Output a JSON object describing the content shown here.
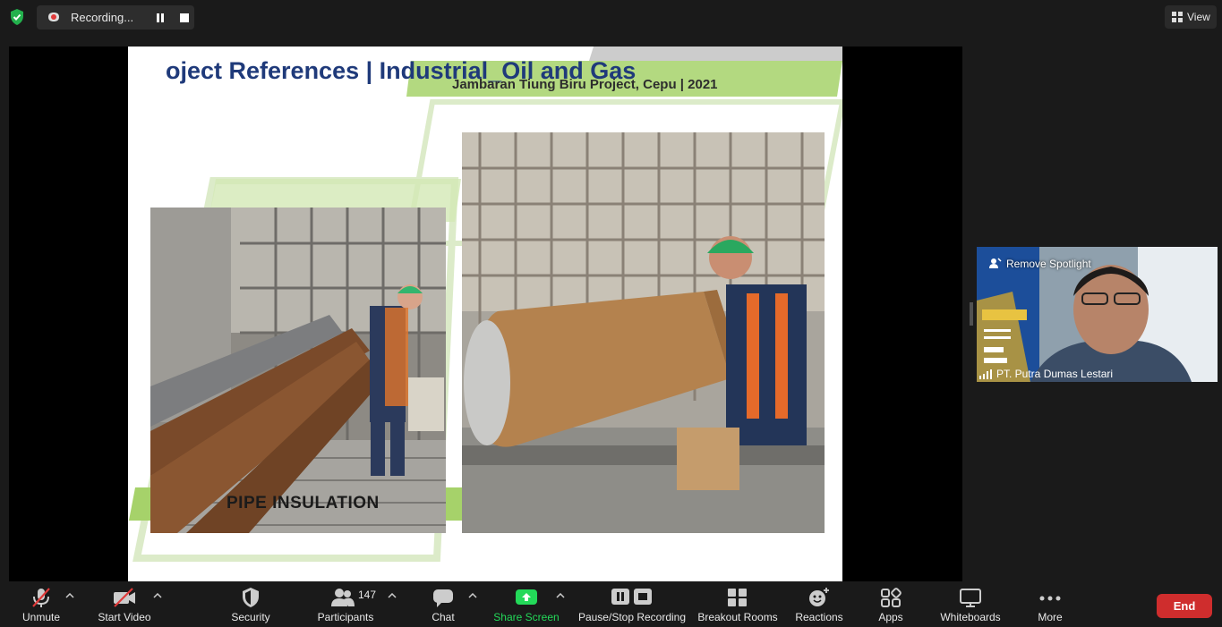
{
  "topbar": {
    "recording_label": "Recording...",
    "view_label": "View"
  },
  "slide": {
    "title": "oject References | Industrial_Oil and Gas",
    "subtitle": "Jambaran Tiung Biru Project, Cepu | 2021",
    "caption": "PIPE INSULATION"
  },
  "speaker": {
    "spotlight_label": "Remove Spotlight",
    "name": "PT. Putra Dumas Lestari"
  },
  "toolbar": {
    "unmute": "Unmute",
    "start_video": "Start Video",
    "security": "Security",
    "participants": "Participants",
    "participants_count": "147",
    "chat": "Chat",
    "share_screen": "Share Screen",
    "recording": "Pause/Stop Recording",
    "breakout": "Breakout Rooms",
    "reactions": "Reactions",
    "apps": "Apps",
    "whiteboards": "Whiteboards",
    "more": "More",
    "end": "End"
  },
  "colors": {
    "share_green": "#23d959",
    "end_red": "#cf2d2d",
    "title_blue": "#1f3a7a",
    "banner_green": "#a6d26a"
  },
  "icons": [
    "shield-check-icon",
    "record-icon",
    "pause-icon",
    "stop-icon",
    "grid-view-icon",
    "mic-off-icon",
    "video-off-icon",
    "security-icon",
    "participants-icon",
    "chat-icon",
    "share-screen-icon",
    "recording-controls-icon",
    "breakout-rooms-icon",
    "reactions-icon",
    "apps-icon",
    "whiteboard-icon",
    "more-icon",
    "spotlight-icon",
    "signal-icon"
  ]
}
